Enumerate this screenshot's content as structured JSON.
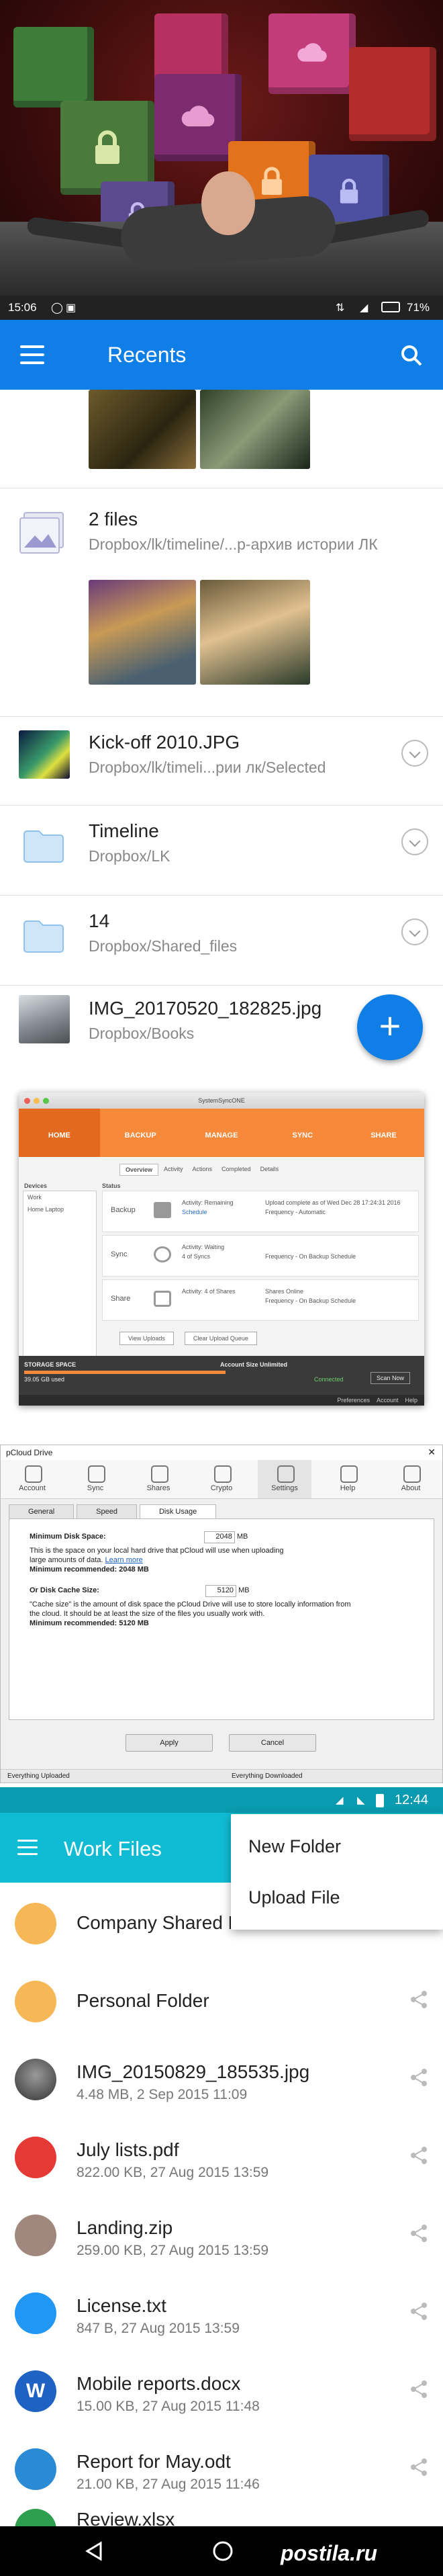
{
  "top_status": {
    "time": "15:06",
    "battery": "71%"
  },
  "recents_bar": {
    "title": "Recents"
  },
  "recents": [
    {
      "title": "2 files",
      "path": "Dropbox/lk/timeline/...р-архив истории ЛК"
    },
    {
      "title": "Kick-off 2010.JPG",
      "path": "Dropbox/lk/timeli...рии лк/Selected"
    },
    {
      "title": "Timeline",
      "path": "Dropbox/LK"
    },
    {
      "title": "14",
      "path": "Dropbox/Shared_files"
    },
    {
      "title": "IMG_20170520_182825.jpg",
      "path": "Dropbox/Books"
    }
  ],
  "fab_label": "+",
  "pcloud_desktop": {
    "window_title": "SystemSyncONE",
    "nav": [
      "HOME",
      "BACKUP",
      "MANAGE",
      "SYNC",
      "SHARE"
    ],
    "tabs": [
      "Overview",
      "Activity",
      "Actions",
      "Completed",
      "Details"
    ],
    "devices_label": "Devices",
    "status_label": "Status",
    "devices": [
      "Work",
      "Home Laptop"
    ],
    "cards": [
      {
        "name": "Backup",
        "activity": "Activity: Remaining",
        "detail": "Upload complete as of Wed Dec 28 17:24:31 2016",
        "freq": "Frequency - Automatic"
      },
      {
        "name": "Sync",
        "activity": "Activity: Waiting",
        "detail": "4 of Syncs",
        "freq": "Frequency - On Backup Schedule"
      },
      {
        "name": "Share",
        "activity": "Activity: 4 of Shares",
        "detail": "Shares Online",
        "freq": "Frequency - On Backup Schedule"
      }
    ],
    "buttons": [
      "View Uploads",
      "Clear Upload Queue"
    ],
    "storage_label": "STORAGE SPACE",
    "storage_value": "Account Size Unlimited",
    "used": "39.05 GB used",
    "connected": "Connected",
    "scan": "Scan Now",
    "footer_links": [
      "Preferences",
      "Account",
      "Help"
    ]
  },
  "pcloud_drive": {
    "window_title": "pCloud Drive",
    "tools": [
      "Account",
      "Sync",
      "Shares",
      "Crypto",
      "Settings",
      "Help",
      "About"
    ],
    "tabs": [
      "General",
      "Speed",
      "Disk Usage"
    ],
    "min_disk_label": "Minimum Disk Space:",
    "min_disk_value": "2048",
    "min_disk_unit": "MB",
    "min_disk_help": "This is the space on your local hard drive that pCloud will use when uploading large amounts of data.",
    "learn_more": "Learn more",
    "min_disk_rec": "Minimum recommended: 2048 MB",
    "cache_label": "Or Disk Cache Size:",
    "cache_value": "5120",
    "cache_unit": "MB",
    "cache_help": "\"Cache size\" is the amount of disk space the pCloud Drive will use to store locally information from the cloud. It should be at least the size of the files you usually work with.",
    "cache_rec": "Minimum recommended: 5120 MB",
    "apply": "Apply",
    "cancel": "Cancel",
    "status_left": "Everything Uploaded",
    "status_right": "Everything Downloaded"
  },
  "work_status": {
    "time": "12:44"
  },
  "work_bar": {
    "title": "Work Files"
  },
  "work_menu": [
    "New Folder",
    "Upload File"
  ],
  "work_files": [
    {
      "name": "Company Shared Fo",
      "meta": "",
      "icon_color": "#f6b756"
    },
    {
      "name": "Personal Folder",
      "meta": "",
      "icon_color": "#f6b756"
    },
    {
      "name": "IMG_20150829_185535.jpg",
      "meta": "4.48 MB, 2 Sep 2015 11:09",
      "icon_color": "#5a5a5a"
    },
    {
      "name": "July lists.pdf",
      "meta": "822.00 KB, 27 Aug 2015 13:59",
      "icon_color": "#e53935"
    },
    {
      "name": "Landing.zip",
      "meta": "259.00 KB, 27 Aug 2015 13:59",
      "icon_color": "#a1887f"
    },
    {
      "name": "License.txt",
      "meta": "847 B, 27 Aug 2015 13:59",
      "icon_color": "#2196f3"
    },
    {
      "name": "Mobile reports.docx",
      "meta": "15.00 KB, 27 Aug 2015 11:48",
      "icon_color": "#1e63c4"
    },
    {
      "name": "Report for May.odt",
      "meta": "21.00 KB, 27 Aug 2015 11:46",
      "icon_color": "#2a8ad4"
    },
    {
      "name": "Review.xlsx",
      "meta": "",
      "icon_color": "#2e9e4f"
    }
  ],
  "watermark": "postila.ru"
}
